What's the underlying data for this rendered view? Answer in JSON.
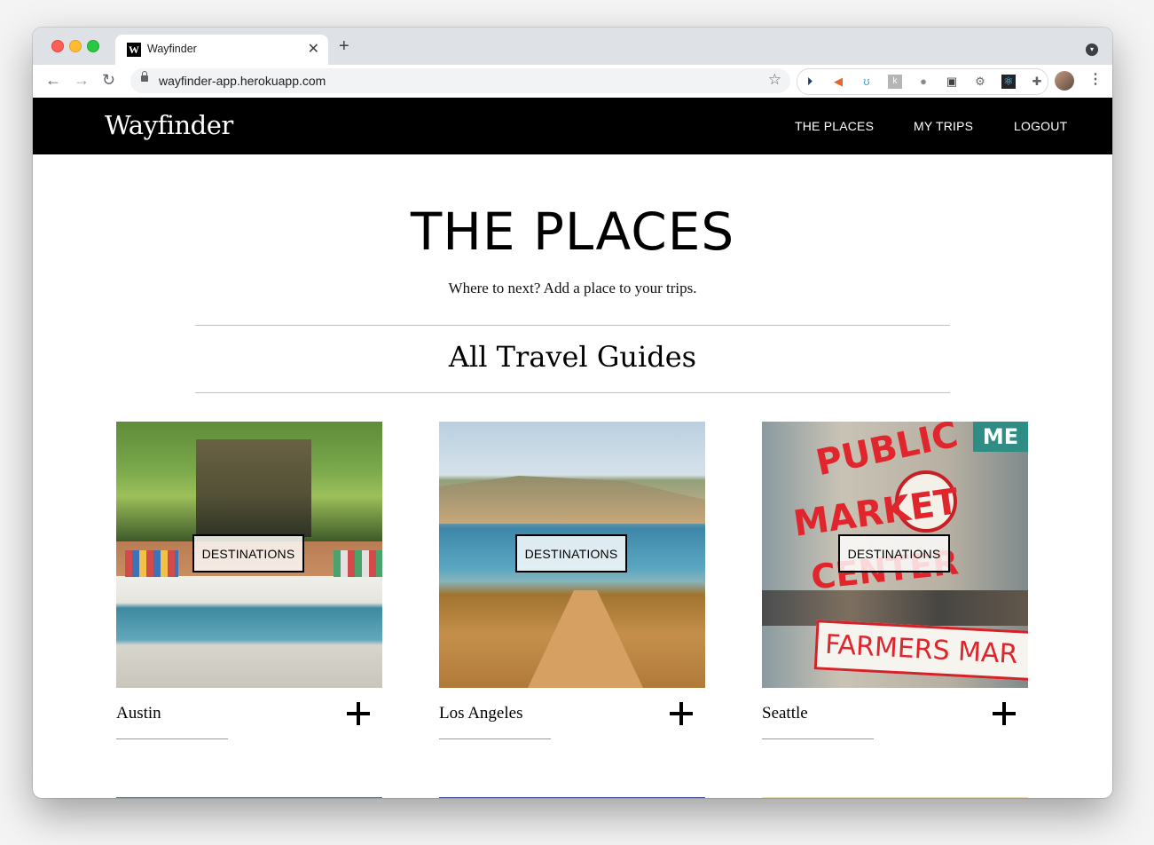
{
  "browser": {
    "tab_title": "Wayfinder",
    "tab_favicon_letter": "W",
    "url": "wayfinder-app.herokuapp.com",
    "extension_icons": [
      "play-circle-icon",
      "megaphone-icon",
      "flask-icon",
      "puzzle-k-icon",
      "chat-bubble-icon",
      "picture-in-picture-icon",
      "gear-icon",
      "react-icon",
      "extensions-puzzle-icon"
    ]
  },
  "site": {
    "logo": "Wayfinder",
    "nav": {
      "places": "THE PLACES",
      "trips": "MY TRIPS",
      "logout": "LOGOUT"
    }
  },
  "page": {
    "title": "THE PLACES",
    "subtitle": "Where to next? Add a place to your trips.",
    "section_title": "All Travel Guides"
  },
  "cards": [
    {
      "name": "Austin",
      "button": "DESTINATIONS"
    },
    {
      "name": "Los Angeles",
      "button": "DESTINATIONS"
    },
    {
      "name": "Seattle",
      "button": "DESTINATIONS"
    }
  ],
  "seattle_image_text": {
    "public": "PUBLIC",
    "market": "MARKET",
    "center": "CENTER",
    "farmers": "FARMERS MAR",
    "me": "ME"
  }
}
